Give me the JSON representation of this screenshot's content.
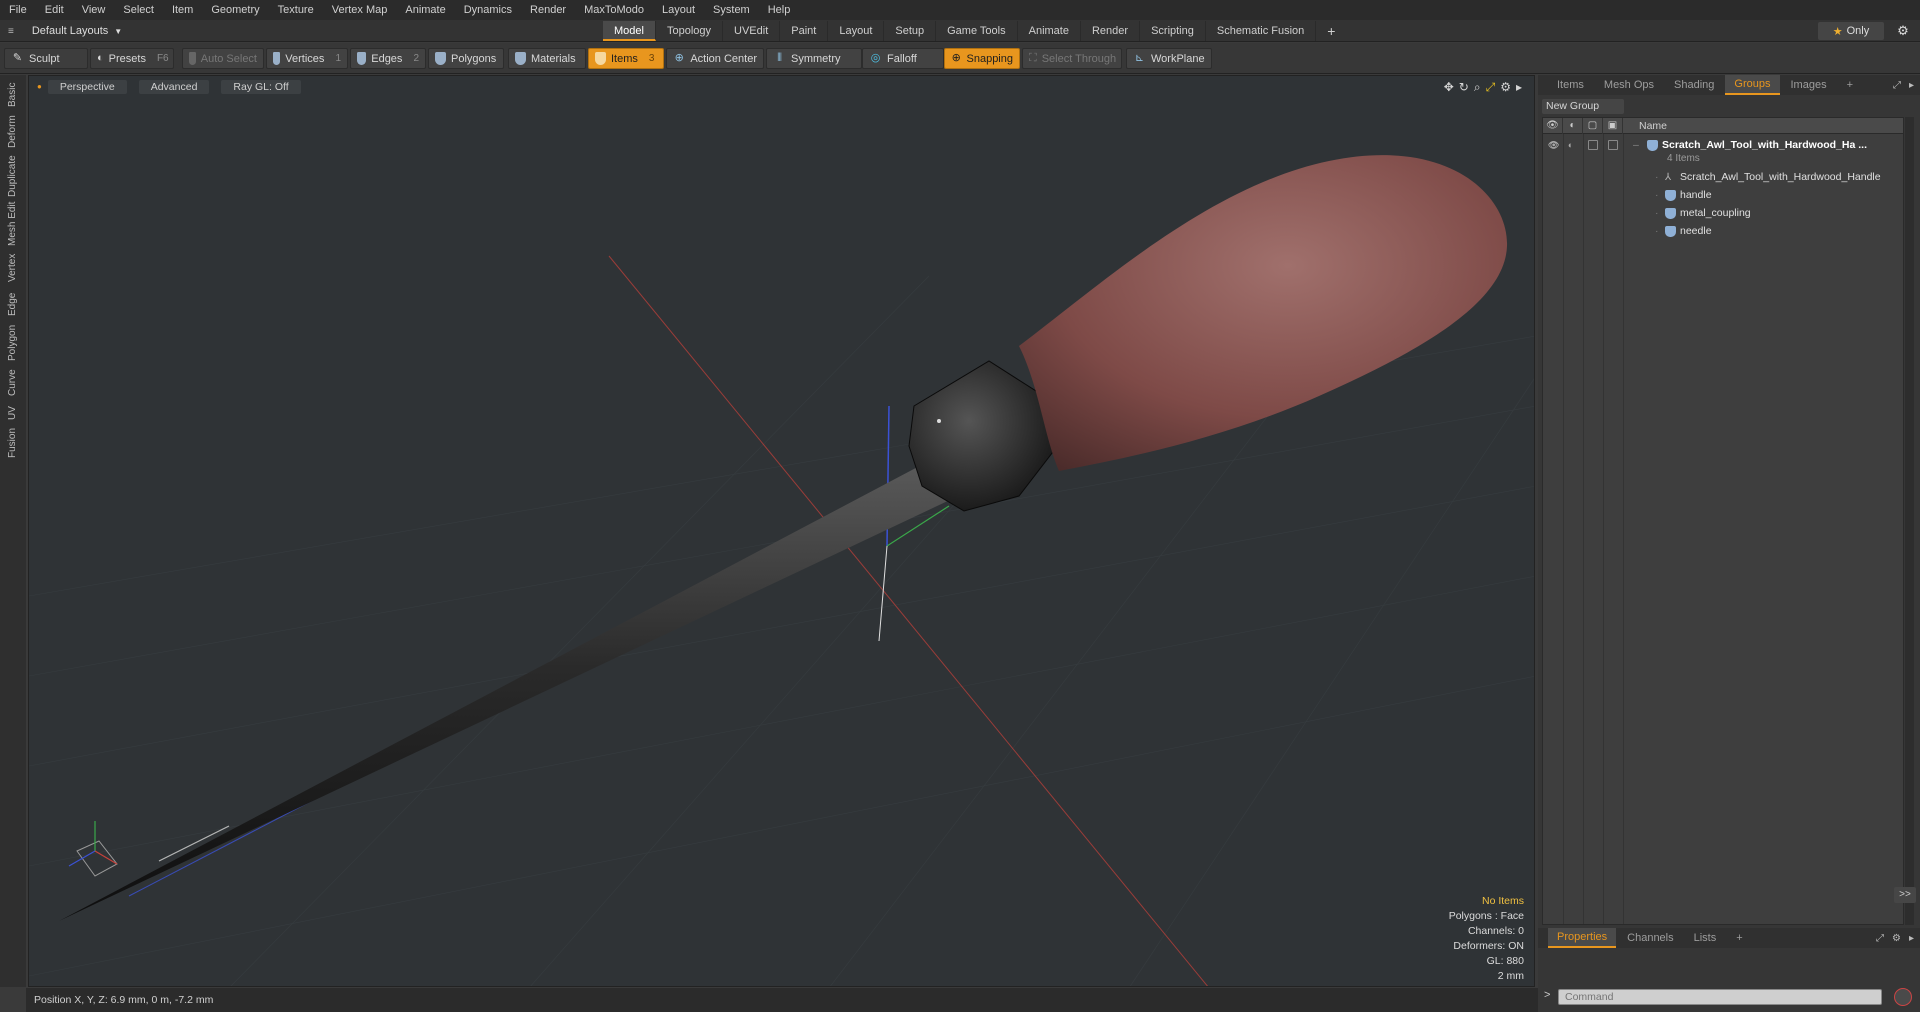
{
  "menu": [
    "File",
    "Edit",
    "View",
    "Select",
    "Item",
    "Geometry",
    "Texture",
    "Vertex Map",
    "Animate",
    "Dynamics",
    "Render",
    "MaxToModo",
    "Layout",
    "System",
    "Help"
  ],
  "layout_selector": "Default Layouts",
  "layout_tabs": [
    {
      "label": "Model",
      "active": true
    },
    {
      "label": "Topology",
      "active": false
    },
    {
      "label": "UVEdit",
      "active": false
    },
    {
      "label": "Paint",
      "active": false
    },
    {
      "label": "Layout",
      "active": false
    },
    {
      "label": "Setup",
      "active": false
    },
    {
      "label": "Game Tools",
      "active": false
    },
    {
      "label": "Animate",
      "active": false
    },
    {
      "label": "Render",
      "active": false
    },
    {
      "label": "Scripting",
      "active": false
    },
    {
      "label": "Schematic Fusion",
      "active": false
    }
  ],
  "add_tab": "+",
  "only_label": "Only",
  "toolbar": {
    "sculpt": "Sculpt",
    "presets": "Presets",
    "presets_key": "F6",
    "auto_select": "Auto Select",
    "vertices": "Vertices",
    "vertices_count": "1",
    "edges": "Edges",
    "edges_count": "2",
    "polygons": "Polygons",
    "materials": "Materials",
    "items": "Items",
    "items_count": "3",
    "action_center": "Action Center",
    "symmetry": "Symmetry",
    "falloff": "Falloff",
    "snapping": "Snapping",
    "select_through": "Select Through",
    "workplane": "WorkPlane"
  },
  "left_tabs": [
    "Basic",
    "Deform",
    "Duplicate",
    "Mesh Edit",
    "Vertex",
    "Edge",
    "Polygon",
    "Curve",
    "UV",
    "Fusion"
  ],
  "viewport": {
    "view": "Perspective",
    "shading": "Advanced",
    "raygl": "Ray GL: Off",
    "stats": {
      "no_items": "No Items",
      "polygons": "Polygons : Face",
      "channels": "Channels: 0",
      "deformers": "Deformers: ON",
      "gl": "GL: 880",
      "grid": "2 mm"
    }
  },
  "status": "Position X, Y, Z:  6.9 mm, 0 m, -7.2 mm",
  "right_panel": {
    "tabs": [
      {
        "label": "Items",
        "active": false
      },
      {
        "label": "Mesh Ops",
        "active": false
      },
      {
        "label": "Shading",
        "active": false
      },
      {
        "label": "Groups",
        "active": true
      },
      {
        "label": "Images",
        "active": false
      }
    ],
    "new_group": "New Group",
    "column_name": "Name",
    "tree": {
      "root": "Scratch_Awl_Tool_with_Hardwood_Ha ...",
      "root_sub": "4 Items",
      "children": [
        "Scratch_Awl_Tool_with_Hardwood_Handle",
        "handle",
        "metal_coupling",
        "needle"
      ]
    },
    "bottom_tabs": [
      {
        "label": "Properties",
        "active": true
      },
      {
        "label": "Channels",
        "active": false
      },
      {
        "label": "Lists",
        "active": false
      }
    ],
    "expand": ">>",
    "command_prompt": ">",
    "command_placeholder": "Command"
  },
  "colors": {
    "accent": "#e8961e",
    "handle": "#8a5552",
    "metal": "#1e1e1e",
    "axis_x": "#c8413a",
    "axis_y": "#3aa84a",
    "axis_z": "#3b52d6"
  }
}
